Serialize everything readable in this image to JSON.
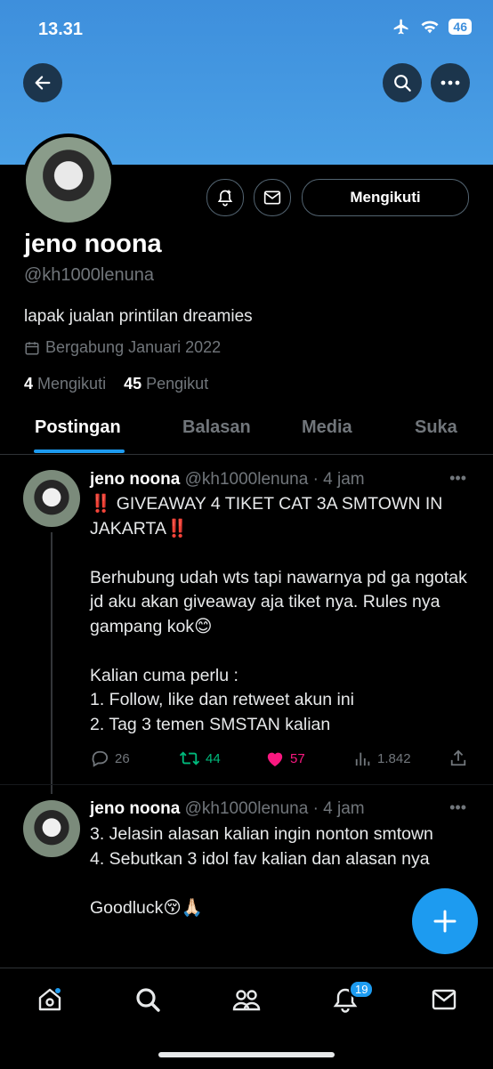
{
  "status_bar": {
    "time": "13.31",
    "battery": "46"
  },
  "colors": {
    "accent": "#1d9bf0",
    "banner": "#4aa0e6",
    "like": "#f91880",
    "retweet": "#00ba7c"
  },
  "profile": {
    "follow_button": "Mengikuti",
    "name": "jeno noona",
    "handle": "@kh1000lenuna",
    "bio": "lapak jualan printilan dreamies",
    "joined": "Bergabung Januari 2022",
    "following_count": "4",
    "following_label": "Mengikuti",
    "followers_count": "45",
    "followers_label": "Pengikut"
  },
  "tabs": [
    "Postingan",
    "Balasan",
    "Media",
    "Suka"
  ],
  "tweets": [
    {
      "name": "jeno noona",
      "meta": "@kh1000lenuna · 4 jam",
      "text": "‼️ GIVEAWAY 4 TIKET CAT 3A SMTOWN IN JAKARTA‼️\n\nBerhubung udah wts tapi nawarnya pd ga ngotak jd aku akan giveaway aja tiket nya. Rules nya gampang kok😊\n\nKalian cuma perlu :\n1. Follow, like dan retweet akun ini\n2. Tag 3 temen SMSTAN kalian",
      "replies": "26",
      "retweets": "44",
      "likes": "57",
      "views": "1.842"
    },
    {
      "name": "jeno noona",
      "meta": "@kh1000lenuna · 4 jam",
      "text": "3. Jelasin alasan kalian ingin nonton smtown\n4. Sebutkan 3 idol fav kalian dan alasan nya\n\nGoodluck😚🙏🏻"
    }
  ],
  "nav": {
    "notifications_badge": "19"
  }
}
